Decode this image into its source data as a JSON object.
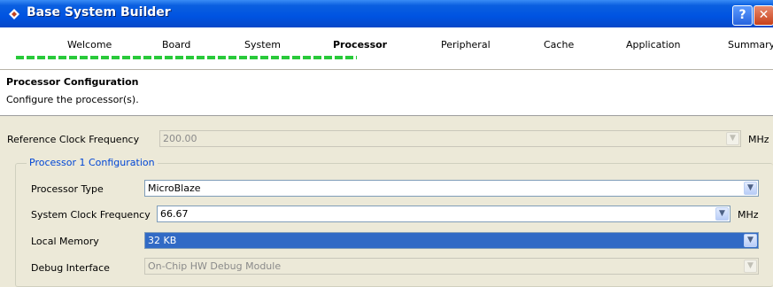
{
  "window": {
    "title": "Base System Builder",
    "help_label": "?",
    "close_label": "✕"
  },
  "steps": [
    {
      "label": "Welcome",
      "active": false
    },
    {
      "label": "Board",
      "active": false
    },
    {
      "label": "System",
      "active": false
    },
    {
      "label": "Processor",
      "active": true
    },
    {
      "label": "Peripheral",
      "active": false
    },
    {
      "label": "Cache",
      "active": false
    },
    {
      "label": "Application",
      "active": false
    },
    {
      "label": "Summary",
      "active": false
    }
  ],
  "header": {
    "title": "Processor Configuration",
    "description": "Configure the processor(s)."
  },
  "form": {
    "reference_clock": {
      "label": "Reference Clock Frequency",
      "value": "200.00",
      "unit": "MHz"
    },
    "group_title": "Processor 1 Configuration",
    "processor_type": {
      "label": "Processor Type",
      "value": "MicroBlaze"
    },
    "system_clock": {
      "label": "System Clock Frequency",
      "value": "66.67",
      "unit": "MHz"
    },
    "local_memory": {
      "label": "Local Memory",
      "value": "32 KB"
    },
    "debug_interface": {
      "label": "Debug Interface",
      "value": "On-Chip HW Debug Module"
    }
  },
  "icons": {
    "dropdown": "chevron-down-icon",
    "app": "app-icon"
  },
  "colors": {
    "title_bar": "#0053e1",
    "selected": "#316ac5",
    "progress": "#29c93a",
    "group_title": "#0046d5"
  }
}
